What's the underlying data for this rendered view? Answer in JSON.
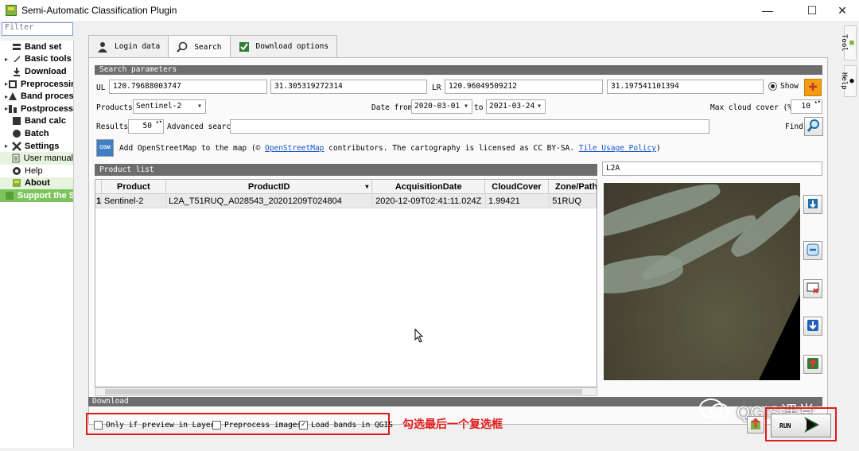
{
  "window": {
    "title": "Semi-Automatic Classification Plugin",
    "minimize": "—",
    "maximize": "☐",
    "close": "✕"
  },
  "filter_placeholder": "Filter",
  "sidebar": {
    "items": [
      {
        "label": "Band set",
        "arrow": "",
        "icon": "band-set-icon"
      },
      {
        "label": "Basic tools",
        "arrow": "▸",
        "icon": "basic-tools-icon"
      },
      {
        "label": "Download",
        "arrow": "",
        "icon": "download-icon"
      },
      {
        "label": "Preprocessing",
        "arrow": "▸",
        "icon": "preprocessing-icon"
      },
      {
        "label": "Band processing",
        "arrow": "▸",
        "icon": "band-processing-icon"
      },
      {
        "label": "Postprocessing",
        "arrow": "▸",
        "icon": "postprocessing-icon"
      },
      {
        "label": "Band calc",
        "arrow": "",
        "icon": "band-calc-icon"
      },
      {
        "label": "Batch",
        "arrow": "",
        "icon": "batch-icon"
      },
      {
        "label": "Settings",
        "arrow": "▸",
        "icon": "settings-icon"
      },
      {
        "label": "User manual",
        "arrow": "",
        "icon": "user-manual-icon"
      },
      {
        "label": "Help",
        "arrow": "",
        "icon": "help-icon"
      },
      {
        "label": "About",
        "arrow": "",
        "icon": "about-icon"
      },
      {
        "label": "Support the SCP",
        "arrow": "",
        "icon": "support-icon"
      }
    ]
  },
  "tabs": [
    {
      "label": "Login data",
      "icon": "user-icon"
    },
    {
      "label": "Search",
      "icon": "search-icon"
    },
    {
      "label": "Download options",
      "icon": "checkbox-icon"
    }
  ],
  "search": {
    "section_title": "Search parameters",
    "ul_label": "UL",
    "ul_x": "120.79688003747",
    "ul_y": "31.305319272314",
    "lr_label": "LR",
    "lr_x": "120.96049509212",
    "lr_y": "31.197541101394",
    "show_label": "Show",
    "products_label": "Products",
    "product_value": "Sentinel-2",
    "date_from_label": "Date from",
    "date_from": "2020-03-01",
    "to_label": "to",
    "date_to": "2021-03-24",
    "max_cloud_label": "Max cloud cover (%)",
    "max_cloud": "10",
    "results_label": "Results",
    "results": "50",
    "advanced_label": "Advanced search",
    "advanced_value": "",
    "find_label": "Find",
    "osm_icon_text": "OSM",
    "osm_prefix": "Add OpenStreetMap to the map (©",
    "osm_link": "OpenStreetMap",
    "osm_middle": "contributors. The cartography is licensed as CC BY-SA.",
    "osm_policy": "Tile Usage Policy",
    "osm_suffix": ")"
  },
  "product_list": {
    "title": "Product list",
    "filter_value": "L2A",
    "columns": [
      "Product",
      "ProductID",
      "AcquisitionDate",
      "CloudCover",
      "Zone/Path"
    ],
    "rows": [
      {
        "num": "1",
        "product": "Sentinel-2",
        "id": "L2A_T51RUQ_A028543_20201209T024804",
        "date": "2020-12-09T02:41:11.024Z",
        "cloud": "1.99421",
        "zone": "51RUQ"
      }
    ]
  },
  "download": {
    "section_title": "Download",
    "only_preview": "Only if preview in Layers",
    "only_preview_checked": "",
    "preprocess": "Preprocess images",
    "preprocess_checked": "",
    "load_bands": "Load bands in QGIS",
    "load_bands_checked": "✓",
    "run_label": "RUN"
  },
  "annotation": "勾选最后一个复选框",
  "watermark": "QGIS课堂",
  "right_tabs": {
    "tool": "Tool",
    "help": "Help"
  },
  "colors": {
    "section_bg": "#6d6d6d",
    "accent_red": "#e01b1b",
    "green": "#7ec45d"
  }
}
